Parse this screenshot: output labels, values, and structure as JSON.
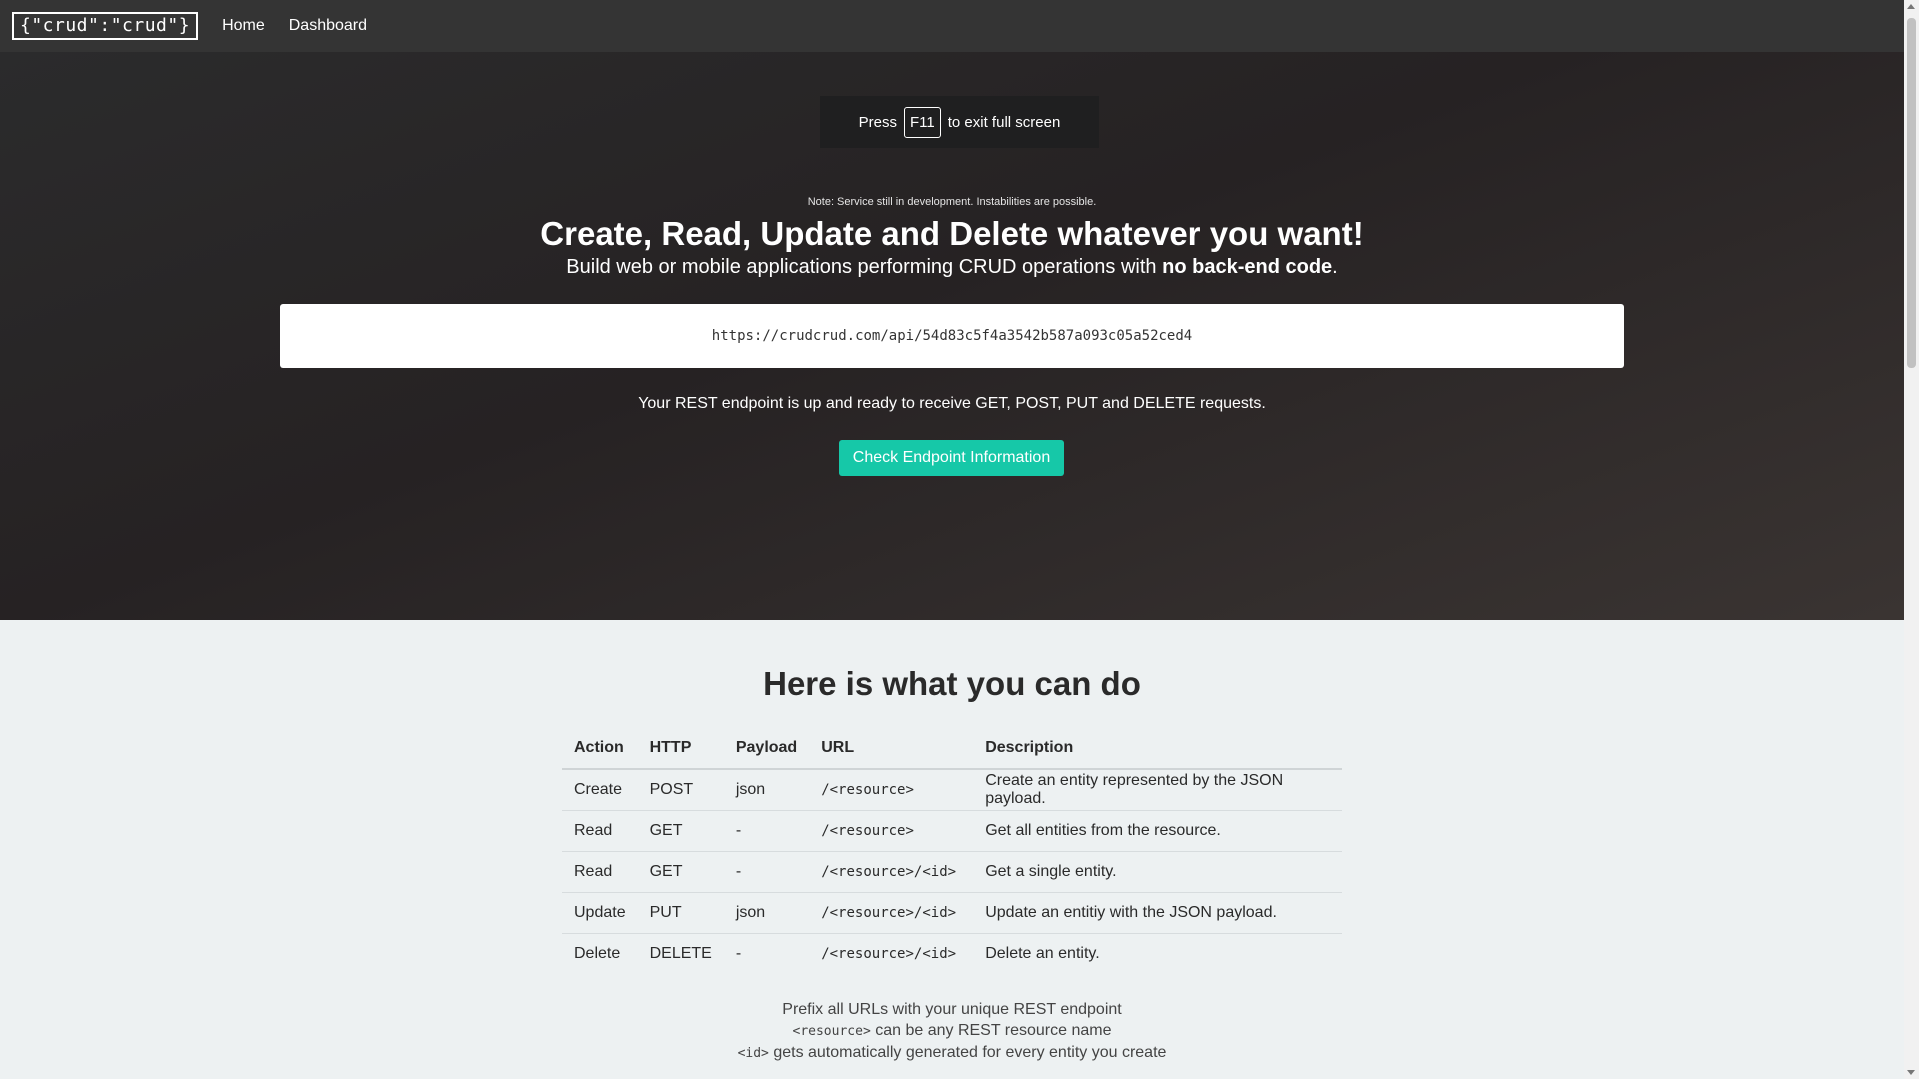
{
  "nav": {
    "brand": "{\"crud\":\"crud\"}",
    "links": [
      "Home",
      "Dashboard"
    ]
  },
  "fullscreen": {
    "press": "Press",
    "key": "F11",
    "rest": "to exit full screen"
  },
  "hero": {
    "note": "Note: Service still in development. Instabilities are possible.",
    "title": "Create, Read, Update and Delete whatever you want!",
    "subtitle_prefix": "Build web or mobile applications performing CRUD operations with ",
    "subtitle_bold": "no back-end code",
    "subtitle_suffix": ".",
    "endpoint": "https://crudcrud.com/api/54d83c5f4a3542b587a093c05a52ced4",
    "ready_text": "Your REST endpoint is up and ready to receive GET, POST, PUT and DELETE requests.",
    "button": "Check Endpoint Information"
  },
  "section": {
    "title": "Here is what you can do",
    "headers": [
      "Action",
      "HTTP",
      "Payload",
      "URL",
      "Description"
    ],
    "rows": [
      [
        "Create",
        "POST",
        "json",
        "/<resource>",
        "Create an entity represented by the JSON payload."
      ],
      [
        "Read",
        "GET",
        "-",
        "/<resource>",
        "Get all entities from the resource."
      ],
      [
        "Read",
        "GET",
        "-",
        "/<resource>/<id>",
        "Get a single entity."
      ],
      [
        "Update",
        "PUT",
        "json",
        "/<resource>/<id>",
        "Update an entitiy with the JSON payload."
      ],
      [
        "Delete",
        "DELETE",
        "-",
        "/<resource>/<id>",
        "Delete an entity."
      ]
    ],
    "footnote1": "Prefix all URLs with your unique REST endpoint",
    "footnote2_code": "<resource>",
    "footnote2_text": " can be any REST resource name",
    "footnote3_code": "<id>",
    "footnote3_text": " gets automatically generated for every entity you create"
  }
}
